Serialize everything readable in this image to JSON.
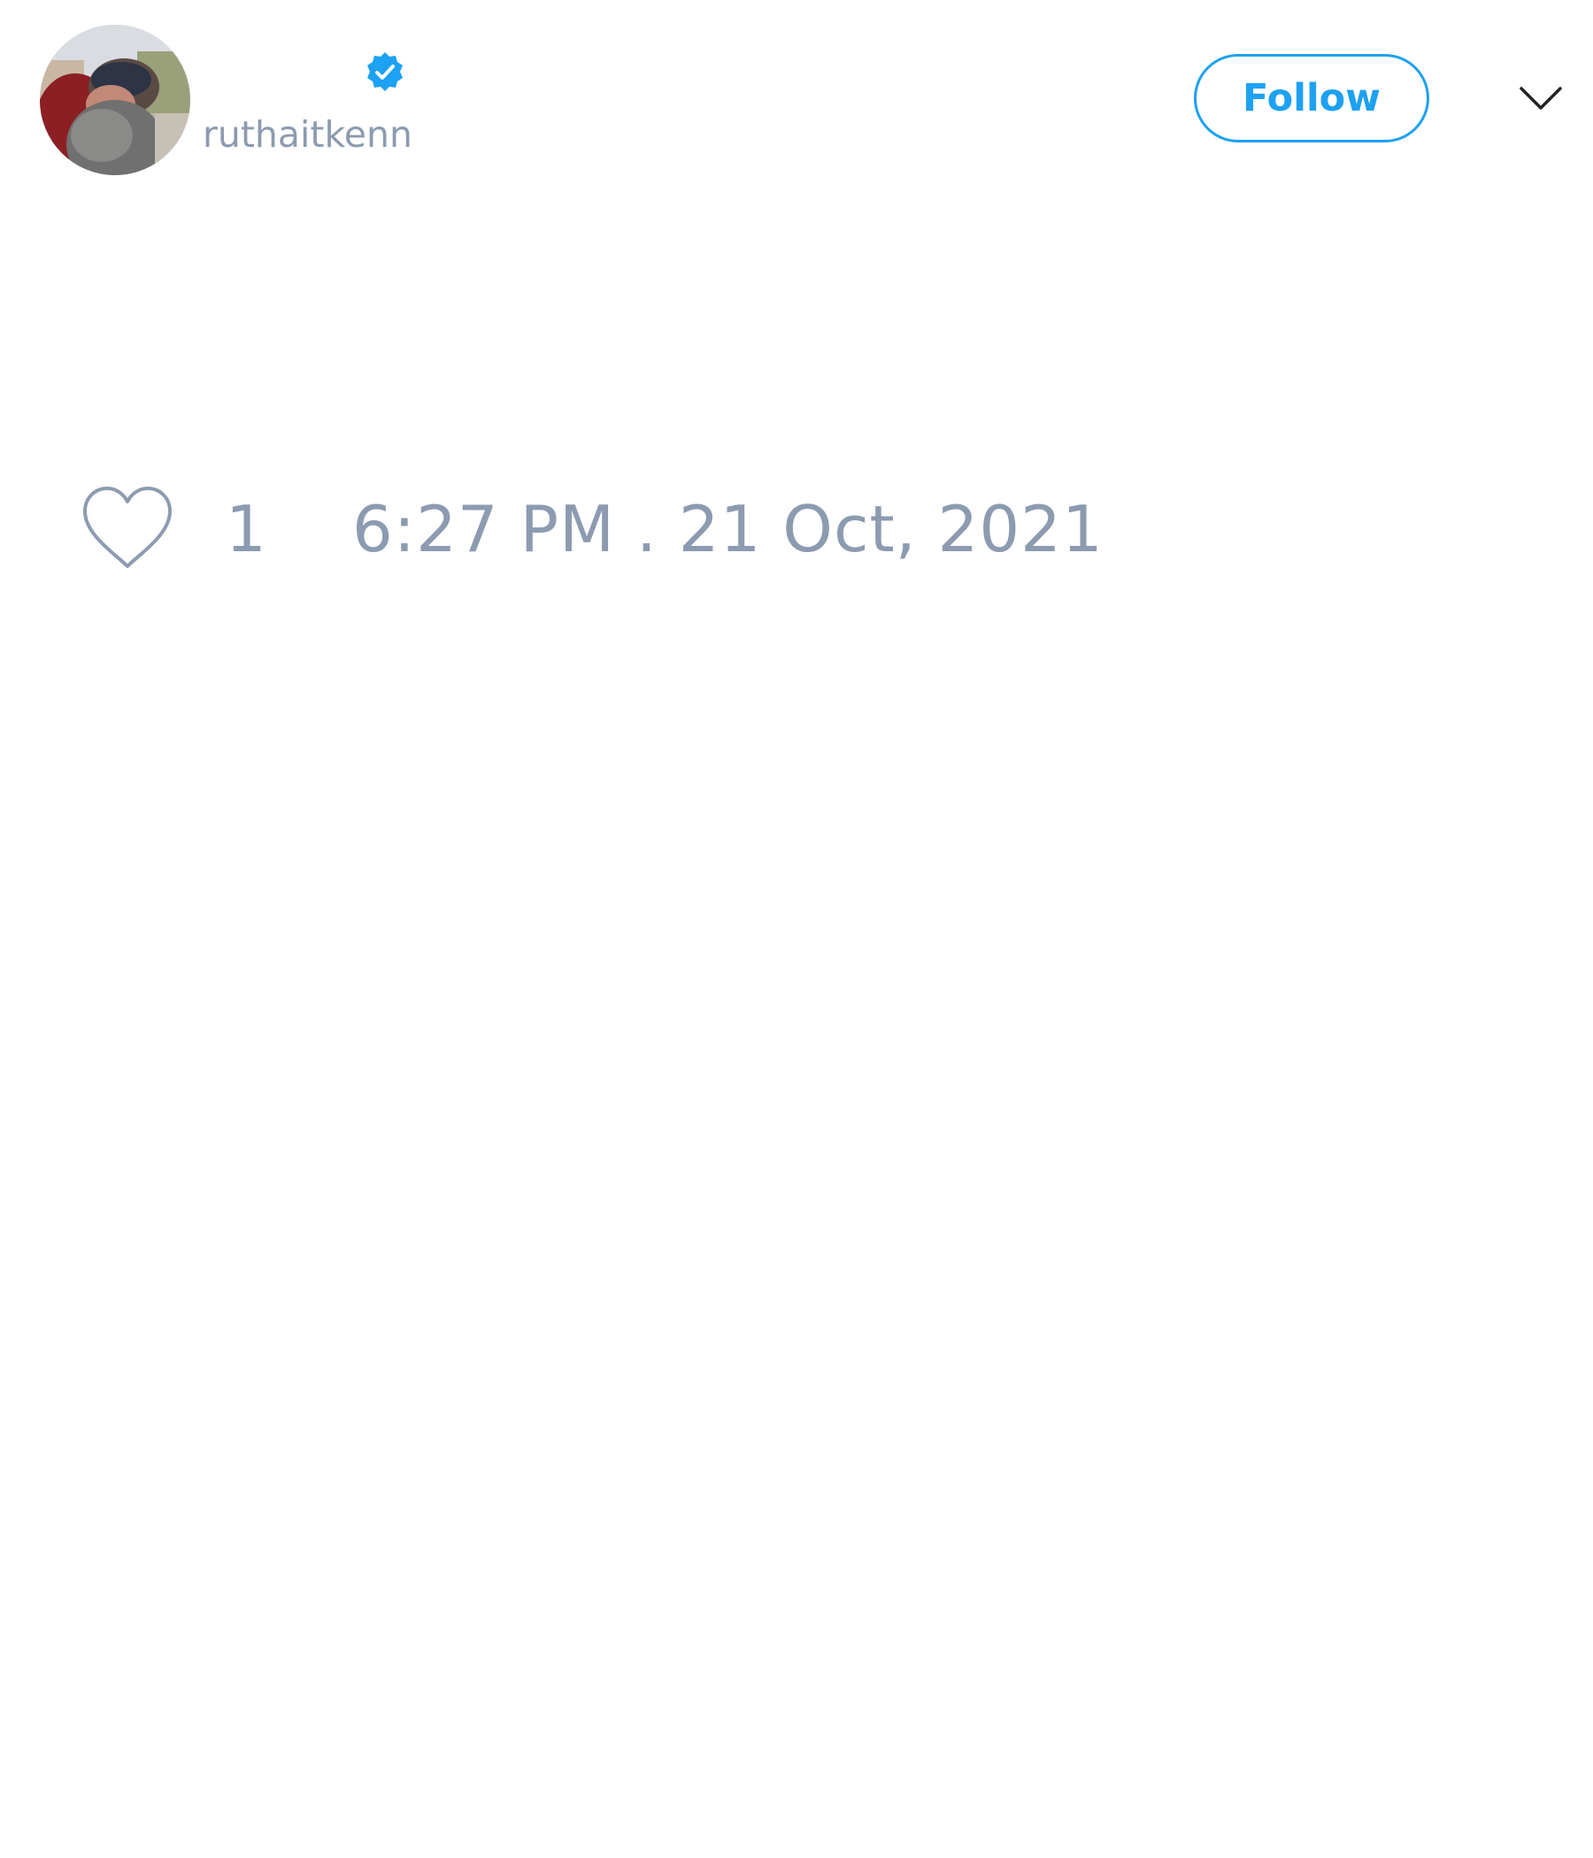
{
  "user": {
    "handle": "ruthaitkenn",
    "verified": true
  },
  "header": {
    "follow_label": "Follow",
    "menu_icon": "chevron-down-icon"
  },
  "tweet": {
    "like_count": "1",
    "timestamp": "6:27 PM . 21 Oct, 2021"
  },
  "colors": {
    "accent": "#1da1f2",
    "muted_text": "#8c9bb0",
    "background": "#ffffff"
  },
  "icons": {
    "verified": "verified-badge-icon",
    "like": "heart-icon"
  }
}
